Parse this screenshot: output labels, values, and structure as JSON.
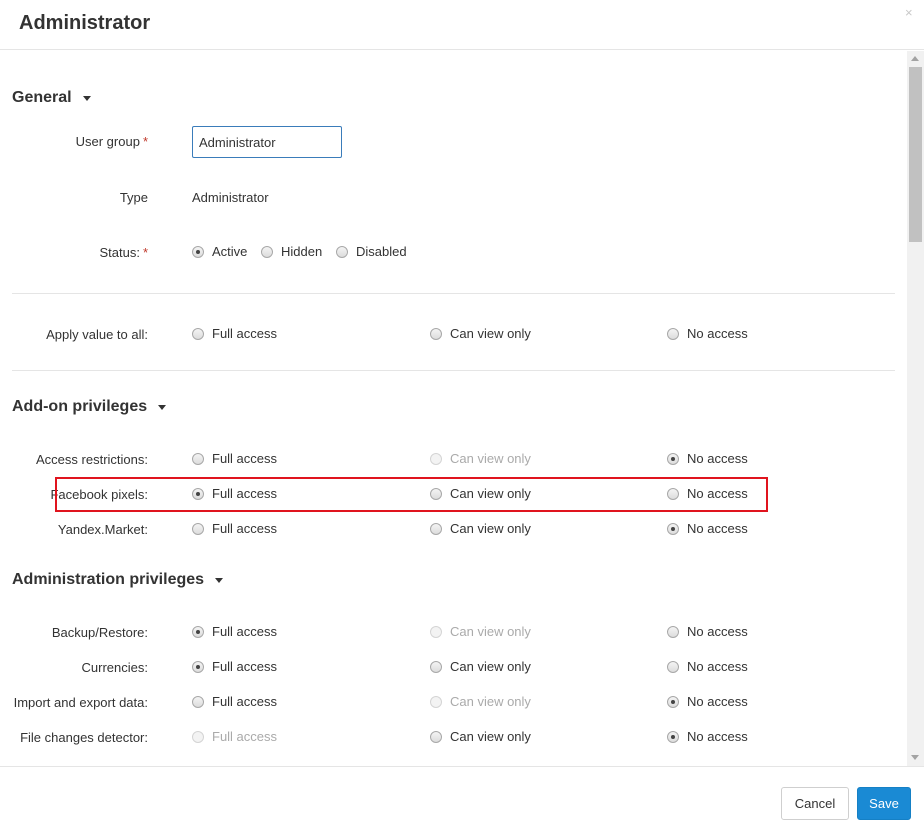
{
  "dialog": {
    "title": "Administrator",
    "close_glyph": "×"
  },
  "general": {
    "title": "General",
    "user_group_label": "User group",
    "required_mark": "*",
    "user_group_value": "Administrator",
    "type_label": "Type",
    "type_value": "Administrator",
    "status_label": "Status:",
    "status_options": [
      "Active",
      "Hidden",
      "Disabled"
    ],
    "status_selected": "Active",
    "apply_label": "Apply value to all:"
  },
  "options": {
    "full": "Full access",
    "view": "Can view only",
    "none": "No access"
  },
  "addon": {
    "title": "Add-on privileges",
    "rows": [
      {
        "label": "Access restrictions:",
        "selected": "none",
        "disabled": [
          "view"
        ]
      },
      {
        "label": "Facebook pixels:",
        "selected": "full",
        "disabled": []
      },
      {
        "label": "Yandex.Market:",
        "selected": "none",
        "disabled": []
      }
    ]
  },
  "admin": {
    "title": "Administration privileges",
    "rows": [
      {
        "label": "Backup/Restore:",
        "selected": "full",
        "disabled": [
          "view"
        ]
      },
      {
        "label": "Currencies:",
        "selected": "full",
        "disabled": []
      },
      {
        "label": "Import and export data:",
        "selected": "none",
        "disabled": [
          "view"
        ]
      },
      {
        "label": "File changes detector:",
        "selected": "none",
        "disabled": [
          "full"
        ]
      }
    ]
  },
  "footer": {
    "cancel_label": "Cancel",
    "save_label": "Save"
  },
  "colors": {
    "accent": "#1a8ad4",
    "highlight": "#e0141e",
    "required": "#c0392b"
  }
}
